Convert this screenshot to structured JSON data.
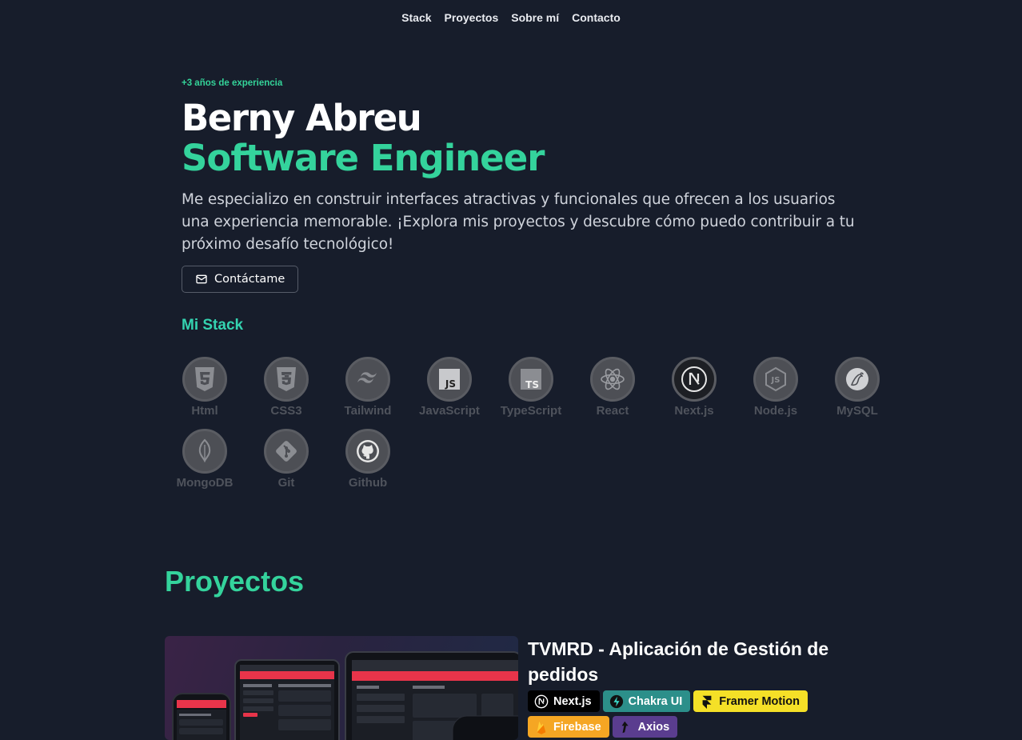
{
  "nav": {
    "items": [
      {
        "label": "Stack"
      },
      {
        "label": "Proyectos"
      },
      {
        "label": "Sobre mí"
      },
      {
        "label": "Contacto"
      }
    ]
  },
  "hero": {
    "experience": "+3 años de experiencia",
    "name": "Berny Abreu",
    "role": "Software Engineer",
    "description": "Me especializo en construir interfaces atractivas y funcionales que ofrecen a los usuarios una experiencia memorable. ¡Explora mis proyectos y descubre cómo puedo contribuir a tu próximo desafío tecnológico!",
    "contact_label": "Contáctame"
  },
  "stack": {
    "title": "Mi Stack",
    "items": [
      {
        "label": "Html",
        "icon": "html5-icon"
      },
      {
        "label": "CSS3",
        "icon": "css3-icon"
      },
      {
        "label": "Tailwind",
        "icon": "tailwind-icon"
      },
      {
        "label": "JavaScript",
        "icon": "javascript-icon"
      },
      {
        "label": "TypeScript",
        "icon": "typescript-icon"
      },
      {
        "label": "React",
        "icon": "react-icon"
      },
      {
        "label": "Next.js",
        "icon": "nextjs-icon"
      },
      {
        "label": "Node.js",
        "icon": "nodejs-icon"
      },
      {
        "label": "MySQL",
        "icon": "mysql-icon"
      },
      {
        "label": "MongoDB",
        "icon": "mongodb-icon"
      },
      {
        "label": "Git",
        "icon": "git-icon"
      },
      {
        "label": "Github",
        "icon": "github-icon"
      }
    ]
  },
  "projects": {
    "title": "Proyectos",
    "items": [
      {
        "name": "TVMRD - Aplicación de Gestión de pedidos",
        "tags": [
          {
            "label": "Next.js",
            "icon": "nextjs-icon",
            "bg": "#000000",
            "fg": "#ffffff"
          },
          {
            "label": "Chakra UI",
            "icon": "chakra-icon",
            "bg": "#2c8f8a",
            "fg": "#ffffff"
          },
          {
            "label": "Framer Motion",
            "icon": "framer-icon",
            "bg": "#f5e027",
            "fg": "#111111"
          },
          {
            "label": "Firebase",
            "icon": "firebase-icon",
            "bg": "#f5a623",
            "fg": "#ffffff"
          },
          {
            "label": "Axios",
            "icon": "axios-icon",
            "bg": "#5a3d8f",
            "fg": "#ffffff"
          }
        ]
      }
    ]
  },
  "colors": {
    "background": "#171d2b",
    "accent": "#34d39c"
  }
}
